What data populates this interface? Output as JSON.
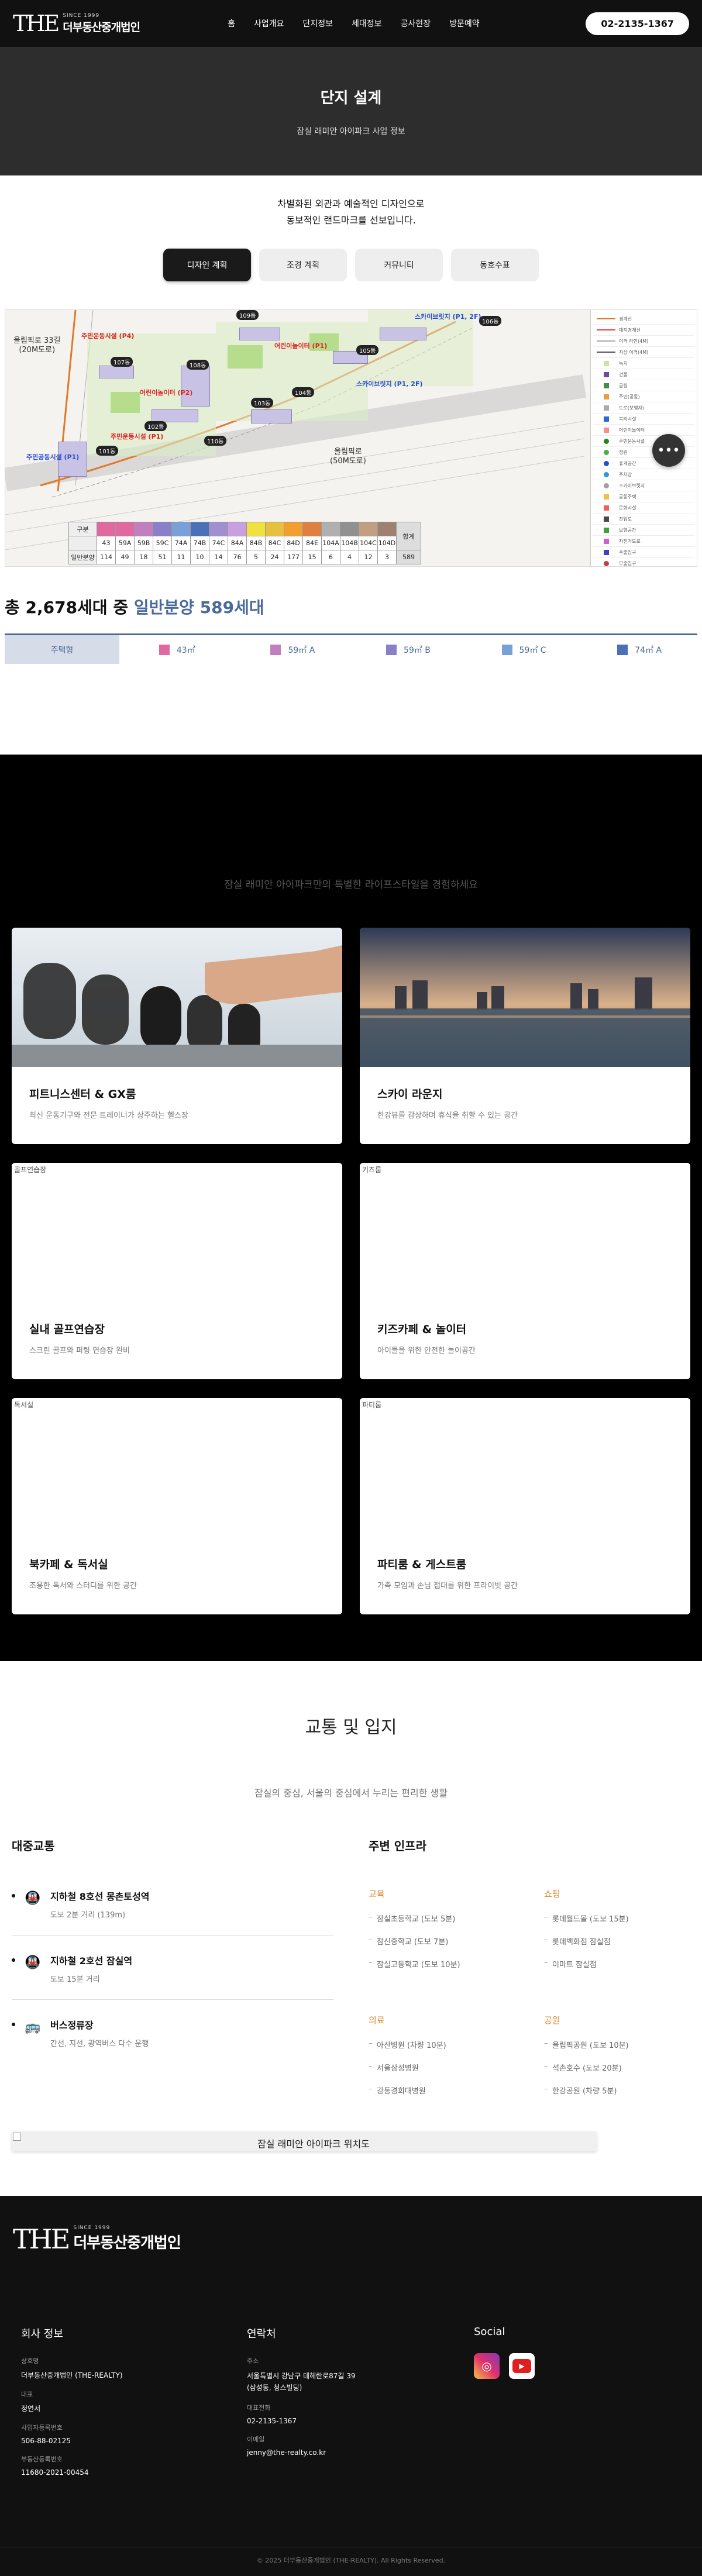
{
  "header": {
    "logo_mark": "THE",
    "logo_since": "SINCE 1999",
    "logo_name": "더부동산중개법인",
    "nav": [
      "홈",
      "사업개요",
      "단지정보",
      "세대정보",
      "공사현장",
      "방문예약"
    ],
    "phone": "02-2135-1367"
  },
  "hero": {
    "title": "단지 설계",
    "subtitle": "잠실 래미안 아이파크 사업 정보"
  },
  "design": {
    "intro_line1": "차별화된 외관과 예술적인 디자인으로",
    "intro_line2": "동보적인 랜드마크를 선보입니다.",
    "tabs": [
      "디자인 계획",
      "조경 계획",
      "커뮤니티",
      "동호수표"
    ],
    "active_tab": "디자인 계획"
  },
  "siteplan": {
    "labels": {
      "road_left": "올림픽로 33길\n(20M도로)",
      "road_bottom": "올림픽로\n(50M도로)"
    },
    "building_tags": [
      "101동",
      "102동",
      "103동",
      "104동",
      "105동",
      "106동",
      "107동",
      "108동",
      "109동",
      "110동"
    ],
    "facilities": [
      {
        "name": "주민운동시설\n(P4)",
        "color": "#d22"
      },
      {
        "name": "어린이놀이터\n(P2)",
        "color": "#d22"
      },
      {
        "name": "어린이놀이터\n(P1)",
        "color": "#d22"
      },
      {
        "name": "주민운동시설\n(P1)",
        "color": "#d22"
      },
      {
        "name": "주민공동시설\n(P1)",
        "color": "#2a4bd0"
      },
      {
        "name": "스카이브릿지\n(P1, 2F)",
        "color": "#2a4bd0"
      },
      {
        "name": "스카이브릿지\n(P1, 2F)",
        "color": "#2a4bd0"
      }
    ],
    "legend": [
      {
        "label": "경계선",
        "sym": "line",
        "color": "#e07a2a"
      },
      {
        "label": "대지경계선",
        "sym": "line",
        "color": "#d44"
      },
      {
        "label": "이격 라인(4M)",
        "sym": "line",
        "color": "#aaa"
      },
      {
        "label": "지상 이격(4M)",
        "sym": "line",
        "color": "#555"
      },
      {
        "label": "녹지",
        "sym": "box",
        "color": "#c8e6a0"
      },
      {
        "label": "건물",
        "sym": "box",
        "color": "#6b4aa0"
      },
      {
        "label": "공원",
        "sym": "box",
        "color": "#4a8a4a"
      },
      {
        "label": "주민(공동)",
        "sym": "box",
        "color": "#e6a040"
      },
      {
        "label": "도로(보행자)",
        "sym": "box",
        "color": "#aaa"
      },
      {
        "label": "복리시설",
        "sym": "box",
        "color": "#2a6ad0"
      },
      {
        "label": "어린이놀이터",
        "sym": "box",
        "color": "#f09090"
      },
      {
        "label": "주민운동시설",
        "sym": "dot",
        "color": "#1a8a1a"
      },
      {
        "label": "정원",
        "sym": "dot",
        "color": "#4ab04a"
      },
      {
        "label": "휴게공간",
        "sym": "dot",
        "color": "#2a4bd0"
      },
      {
        "label": "주차장",
        "sym": "dot",
        "color": "#2a9ad0"
      },
      {
        "label": "스카이브릿지",
        "sym": "dot",
        "color": "#a0a0a0"
      },
      {
        "label": "공동주택",
        "sym": "box",
        "color": "#f0c040"
      },
      {
        "label": "문화시설",
        "sym": "box",
        "color": "#f06060"
      },
      {
        "label": "진입로",
        "sym": "box",
        "color": "#4a4a4a"
      },
      {
        "label": "보행공간",
        "sym": "box",
        "color": "#40a040"
      },
      {
        "label": "자전거도로",
        "sym": "box",
        "color": "#d060d0"
      },
      {
        "label": "주출입구",
        "sym": "box",
        "color": "#4040c0"
      },
      {
        "label": "부출입구",
        "sym": "dot",
        "color": "#c04040"
      }
    ],
    "unit_table": {
      "row_labels": [
        "구분",
        "일반분양"
      ],
      "types": [
        "43",
        "59A",
        "59B",
        "59C",
        "74A",
        "74B",
        "74C",
        "84A",
        "84B",
        "84C",
        "84D",
        "84E",
        "104A",
        "104B",
        "104C",
        "104D"
      ],
      "type_colors": [
        "#e06aa0",
        "#e06aa0",
        "#c080c0",
        "#8a80c8",
        "#7aa0d8",
        "#4a70b8",
        "#a090d0",
        "#c8a0e0",
        "#f0e040",
        "#e8c040",
        "#f0a030",
        "#e08040",
        "#b0b0b0",
        "#909090",
        "#c0a080",
        "#a08070"
      ],
      "counts": [
        "114",
        "49",
        "18",
        "51",
        "11",
        "10",
        "14",
        "76",
        "5",
        "24",
        "177",
        "15",
        "6",
        "4",
        "12",
        "3"
      ],
      "total_label": "합계",
      "total": "589"
    }
  },
  "totals": {
    "prefix": "총 2,678세대 중",
    "highlight": "일반분양 589세대"
  },
  "type_bar": {
    "selected": "주택형",
    "items": [
      {
        "label": "43㎡",
        "color": "#e06aa0"
      },
      {
        "label": "59㎡ A",
        "color": "#c080c0"
      },
      {
        "label": "59㎡ B",
        "color": "#8a80c8"
      },
      {
        "label": "59㎡ C",
        "color": "#7aa0d8"
      },
      {
        "label": "74㎡ A",
        "color": "#4a70b8"
      }
    ]
  },
  "community": {
    "lead": "잠실 래미안 아이파크만의 특별한 라이프스타일을 경험하세요",
    "cards": [
      {
        "title": "피트니스센터 & GX룸",
        "desc": "최신 운동기구와 전문 트레이너가 상주하는 헬스장",
        "alt": "",
        "image": "fitness"
      },
      {
        "title": "스카이 라운지",
        "desc": "한강뷰를 감상하며 휴식을 취할 수 있는 공간",
        "alt": "",
        "image": "skyline"
      },
      {
        "title": "실내 골프연습장",
        "desc": "스크린 골프와 퍼팅 연습장 완비",
        "alt": "골프연습장",
        "image": "broken"
      },
      {
        "title": "키즈카페 & 놀이터",
        "desc": "아이들을 위한 안전한 놀이공간",
        "alt": "키즈룸",
        "image": "broken"
      },
      {
        "title": "북카페 & 독서실",
        "desc": "조용한 독서와 스터디를 위한 공간",
        "alt": "독서실",
        "image": "broken"
      },
      {
        "title": "파티룸 & 게스트룸",
        "desc": "가족 모임과 손님 접대를 위한 프라이빗 공간",
        "alt": "파티룸",
        "image": "broken"
      }
    ]
  },
  "transport": {
    "title": "교통 및 입지",
    "subtitle": "잠실의 중심, 서울의 중심에서 누리는 편리한 생활",
    "public_title": "대중교통",
    "public": [
      {
        "name": "지하철 8호선 몽촌토성역",
        "desc": "도보 2분 거리 (139m)",
        "icon": "subway-icon"
      },
      {
        "name": "지하철 2호선 잠실역",
        "desc": "도보 15분 거리",
        "icon": "subway-icon"
      },
      {
        "name": "버스정류장",
        "desc": "간선, 지선, 광역버스 다수 운행",
        "icon": "bus-icon"
      }
    ],
    "infra_title": "주변 인프라",
    "infra": [
      {
        "category": "교육",
        "items": [
          "잠실초등학교 (도보 5분)",
          "잠신중학교 (도보 7분)",
          "잠실고등학교 (도보 10분)"
        ]
      },
      {
        "category": "쇼핑",
        "items": [
          "롯데월드몰 (도보 15분)",
          "롯데백화점 잠실점",
          "이마트 잠실점"
        ]
      },
      {
        "category": "의료",
        "items": [
          "아산병원 (차량 10분)",
          "서울삼성병원",
          "강동경희대병원"
        ]
      },
      {
        "category": "공원",
        "items": [
          "올림픽공원 (도보 10분)",
          "석촌호수 (도보 20분)",
          "한강공원 (차량 5분)"
        ]
      }
    ],
    "location_caption": "잠실 래미안 아이파크 위치도"
  },
  "footer": {
    "company_title": "회사 정보",
    "company": [
      {
        "label": "상호명",
        "value": "더부동산중개법인 (THE-REALTY)"
      },
      {
        "label": "대표",
        "value": "정연서"
      },
      {
        "label": "사업자등록번호",
        "value": "506-88-02125"
      },
      {
        "label": "부동산등록번호",
        "value": "11680-2021-00454"
      }
    ],
    "contact_title": "연락처",
    "contact": [
      {
        "label": "주소",
        "value": "서울특별시 강남구 테헤란로87길 39\n(삼성동, 청스빌딩)"
      },
      {
        "label": "대표전화",
        "value": "02-2135-1367"
      },
      {
        "label": "이메일",
        "value": "jenny@the-realty.co.kr"
      }
    ],
    "social_title": "Social",
    "copyright": "© 2025 더부동산중개법인 (THE-REALTY). All Rights Reserved."
  }
}
